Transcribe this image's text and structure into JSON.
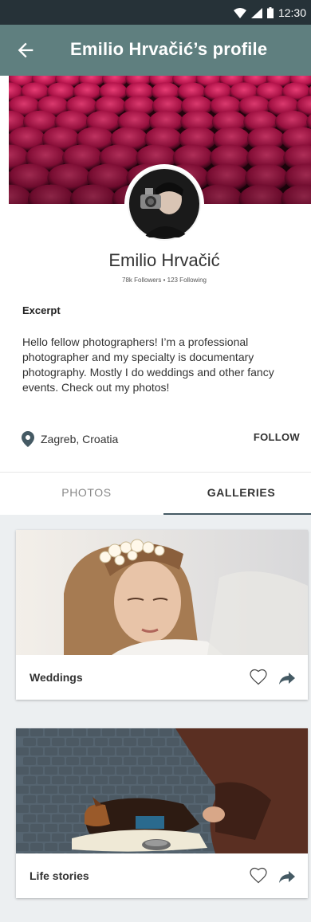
{
  "status_bar": {
    "time": "12:30"
  },
  "app_bar": {
    "title": "Emilio Hrvačić’s profile"
  },
  "profile": {
    "name": "Emilio Hrvačić",
    "stats": "78k Followers  •  123 Following",
    "excerpt_title": "Excerpt",
    "excerpt_body": "Hello fellow photographers! I’m a professional photographer and my specialty is documentary photography. Mostly I do weddings and other fancy events. Check out my photos!",
    "location": "Zagreb, Croatia",
    "follow_label": "FOLLOW"
  },
  "tabs": [
    {
      "label": "PHOTOS",
      "active": false
    },
    {
      "label": "GALLERIES",
      "active": true
    }
  ],
  "galleries": [
    {
      "label": "Weddings"
    },
    {
      "label": "Life stories"
    }
  ],
  "colors": {
    "status_bar": "#263238",
    "app_bar": "#5f7f7f",
    "tab_indicator": "#455a64",
    "grid_bg": "#eceff1"
  }
}
